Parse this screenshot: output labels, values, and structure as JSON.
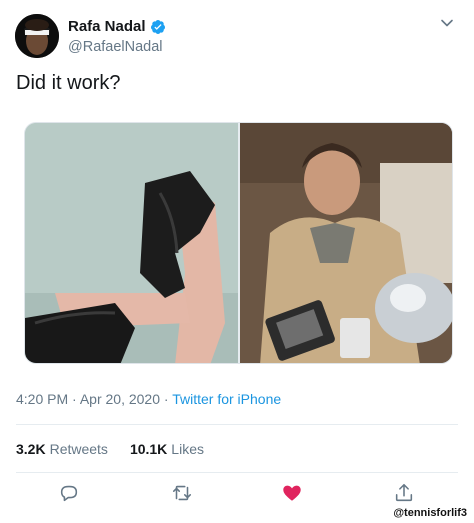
{
  "header": {
    "name": "Rafa Nadal",
    "handle": "@RafaelNadal",
    "verified_icon": "verified-badge-icon",
    "menu_icon": "chevron-down-icon"
  },
  "tweet": {
    "text": "Did it work?"
  },
  "meta": {
    "time": "4:20 PM",
    "sep": "·",
    "date": "Apr 20, 2020",
    "source": "Twitter for iPhone"
  },
  "stats": {
    "retweets_count": "3.2K",
    "retweets_label": "Retweets",
    "likes_count": "10.1K",
    "likes_label": "Likes"
  },
  "actions": {
    "reply_icon": "reply-icon",
    "retweet_icon": "retweet-icon",
    "like_icon": "heart-icon",
    "share_icon": "share-icon"
  },
  "colors": {
    "accent": "#1b95e0",
    "verified": "#1da1f2",
    "liked": "#e0245e",
    "secondary_text": "#657786"
  },
  "watermark": "@tennisforlif3"
}
